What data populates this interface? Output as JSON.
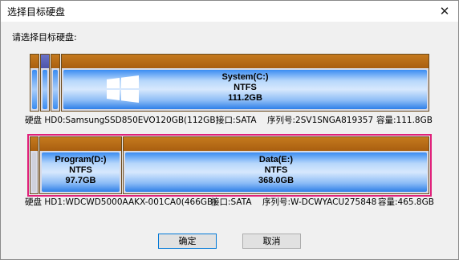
{
  "window": {
    "title": "选择目标硬盘",
    "close_glyph": "✕"
  },
  "prompt": "请选择目标硬盘:",
  "disks": [
    {
      "partitions": [
        {
          "name": "",
          "fs": "",
          "size": ""
        },
        {
          "name": "",
          "fs": "",
          "size": ""
        },
        {
          "name": "",
          "fs": "",
          "size": ""
        },
        {
          "name": "System(C:)",
          "fs": "NTFS",
          "size": "111.2GB",
          "icon": "windows-logo-icon"
        }
      ],
      "info": {
        "disk": "硬盘 HD0:SamsungSSD850EVO120GB(112GB)",
        "interface": "接口:SATA",
        "serial": "序列号:2SV1SNGA819357",
        "capacity": "容量:111.8GB"
      }
    },
    {
      "selected": true,
      "partitions": [
        {
          "name": "",
          "fs": "",
          "size": ""
        },
        {
          "name": "Program(D:)",
          "fs": "NTFS",
          "size": "97.7GB"
        },
        {
          "name": "Data(E:)",
          "fs": "NTFS",
          "size": "368.0GB"
        }
      ],
      "info": {
        "disk": "硬盘 HD1:WDCWD5000AAKX-001CA0(466GB)",
        "interface": "接口:SATA",
        "serial": "序列号:W-DCWYACU275848",
        "capacity": "容量:465.8GB"
      }
    }
  ],
  "buttons": {
    "ok": "确定",
    "cancel": "取消"
  },
  "colors": {
    "selection_border": "#e0207a",
    "partition_cap": "#a95f10",
    "partition_fill": "#3a8cf2"
  }
}
